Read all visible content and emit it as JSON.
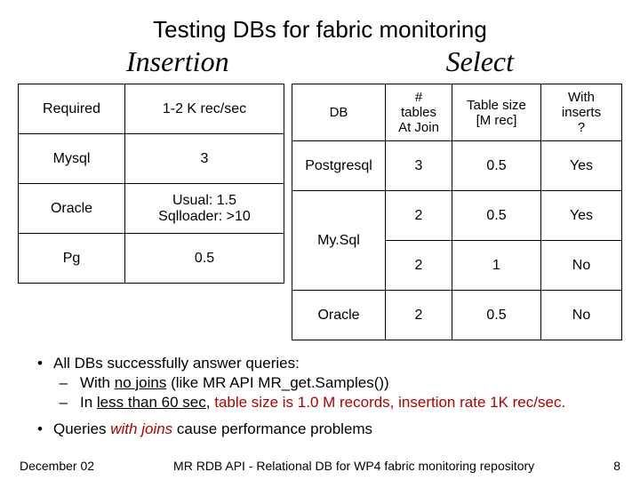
{
  "title": "Testing DBs for fabric monitoring",
  "sub_left": "Insertion",
  "sub_right": "Select",
  "left_table": {
    "h1": "Required",
    "h2": "1-2 K rec/sec",
    "r1c1": "Mysql",
    "r1c2": "3",
    "r2c1": "Oracle",
    "r2c2a": "Usual: 1.5",
    "r2c2b": "Sqlloader: >10",
    "r3c1": "Pg",
    "r3c2": "0.5"
  },
  "right_table": {
    "h1": "DB",
    "h2a": "#",
    "h2b": "tables",
    "h2c": "At Join",
    "h3a": "Table size",
    "h3b": "[M rec]",
    "h4a": "With",
    "h4b": "inserts",
    "h4c": "?",
    "r1c1": "Postgresql",
    "r1c2": "3",
    "r1c3": "0.5",
    "r1c4": "Yes",
    "r2c1": "My.Sql",
    "r2c2": "2",
    "r2c3": "0.5",
    "r2c4": "Yes",
    "r3c2": "2",
    "r3c3": "1",
    "r3c4": "No",
    "r4c1": "Oracle",
    "r4c2": "2",
    "r4c3": "0.5",
    "r4c4": "No"
  },
  "bullets": {
    "b1": "All DBs successfully answer queries:",
    "b1a_pre": "With ",
    "b1a_u": "no joins",
    "b1a_post": " (like MR API MR_get.Samples())",
    "b1b_pre": "In ",
    "b1b_u": "less than 60 sec",
    "b1b_mid": ", ",
    "b1b_red": "table size is 1.0 M records, insertion rate 1K rec/sec.",
    "b2_pre": "Queries ",
    "b2_i": "with joins",
    "b2_post": " cause performance problems"
  },
  "footer": {
    "left": "December 02",
    "center": "MR RDB API - Relational DB for WP4 fabric monitoring repository",
    "right": "8"
  },
  "chart_data": [
    {
      "type": "table",
      "title": "Insertion",
      "columns": [
        "Required",
        "1-2 K rec/sec"
      ],
      "rows": [
        [
          "Mysql",
          "3"
        ],
        [
          "Oracle",
          "Usual: 1.5 / Sqlloader: >10"
        ],
        [
          "Pg",
          "0.5"
        ]
      ]
    },
    {
      "type": "table",
      "title": "Select",
      "columns": [
        "DB",
        "# tables At Join",
        "Table size [M rec]",
        "With inserts ?"
      ],
      "rows": [
        [
          "Postgresql",
          3,
          0.5,
          "Yes"
        ],
        [
          "My.Sql",
          2,
          0.5,
          "Yes"
        ],
        [
          "My.Sql",
          2,
          1,
          "No"
        ],
        [
          "Oracle",
          2,
          0.5,
          "No"
        ]
      ]
    }
  ]
}
